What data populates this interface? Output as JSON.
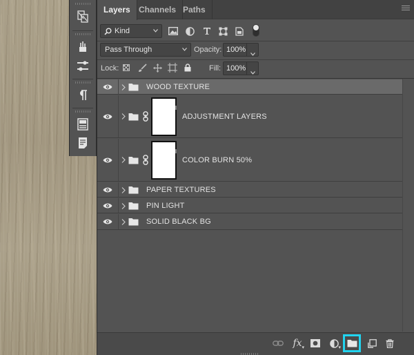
{
  "canvas": {
    "texture": "wood-texture",
    "color": "#a89d86"
  },
  "dock": {
    "buttons": [
      {
        "icon": "character-paragraph-styles-icon"
      },
      {
        "icon": "brushes-icon"
      },
      {
        "icon": "brush-settings-icon"
      },
      {
        "icon": "paragraph-icon"
      },
      {
        "icon": "properties-icon"
      },
      {
        "icon": "notes-icon"
      }
    ]
  },
  "tabs": [
    {
      "label": "Layers",
      "active": true
    },
    {
      "label": "Channels",
      "active": false
    },
    {
      "label": "Paths",
      "active": false
    }
  ],
  "filter": {
    "kind_label": "Kind",
    "icons": [
      "pixel-filter-icon",
      "adjustment-filter-icon",
      "type-filter-icon",
      "shape-filter-icon",
      "smart-object-filter-icon",
      "filter-toggle-icon"
    ]
  },
  "blend": {
    "mode": "Pass Through",
    "opacity_label": "Opacity:",
    "opacity_value": "100%"
  },
  "lock": {
    "label": "Lock:",
    "fill_label": "Fill:",
    "fill_value": "100%",
    "icons": [
      "lock-transparent-icon",
      "lock-image-icon",
      "lock-position-icon",
      "lock-artboard-icon",
      "lock-all-icon"
    ]
  },
  "layers": [
    {
      "name": "WOOD TEXTURE",
      "selected": true,
      "has_thumb": false
    },
    {
      "name": "ADJUSTMENT LAYERS",
      "selected": false,
      "has_thumb": true
    },
    {
      "name": "COLOR BURN 50%",
      "selected": false,
      "has_thumb": true
    },
    {
      "name": "PAPER TEXTURES",
      "selected": false,
      "has_thumb": false
    },
    {
      "name": "PIN LIGHT",
      "selected": false,
      "has_thumb": false
    },
    {
      "name": "SOLID BLACK BG",
      "selected": false,
      "has_thumb": false
    }
  ],
  "bottom_bar": {
    "buttons": [
      "link-layers-icon",
      "fx-icon",
      "add-mask-icon",
      "adjustment-layer-icon",
      "new-group-icon",
      "new-layer-icon",
      "delete-layer-icon"
    ],
    "fx_label": "fx",
    "highlighted": "new-group-icon",
    "highlight_color": "#21d4f0"
  }
}
